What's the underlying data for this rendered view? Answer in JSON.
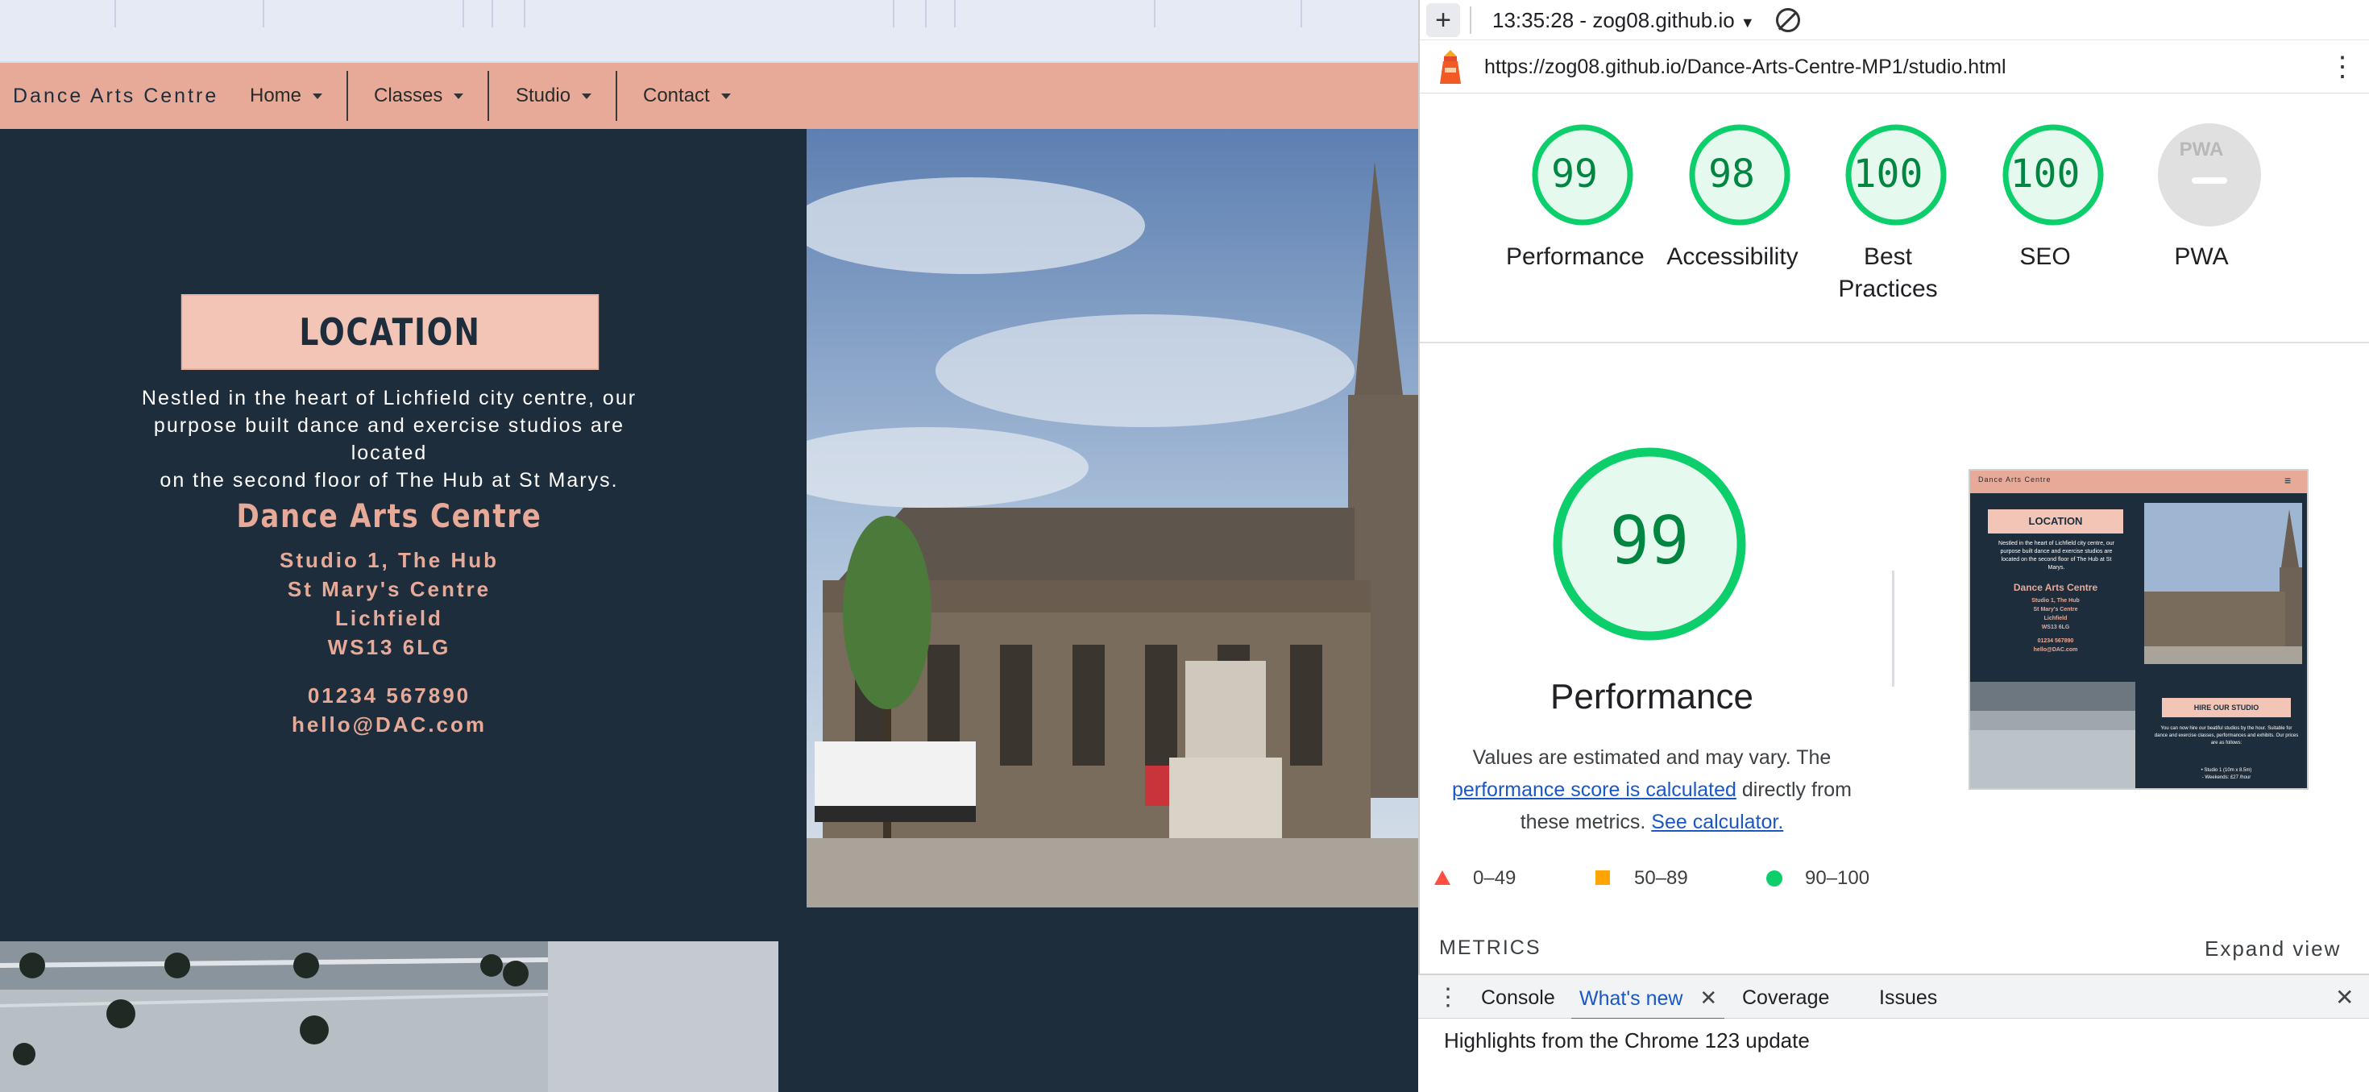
{
  "site": {
    "brand": "Dance Arts Centre",
    "nav": [
      {
        "label": "Home"
      },
      {
        "label": "Classes"
      },
      {
        "label": "Studio"
      },
      {
        "label": "Contact"
      }
    ],
    "location": {
      "heading": "LOCATION",
      "text_lines": [
        "Nestled in the heart of Lichfield city centre, our",
        "purpose built dance and exercise studios are located",
        "on the second floor of The Hub at St Marys."
      ],
      "name": "Dance Arts Centre",
      "address": [
        "Studio 1, The Hub",
        "St Mary's Centre",
        "Lichfield",
        "WS13 6LG"
      ],
      "phone": "01234 567890",
      "email": "hello@DAC.com"
    }
  },
  "devtools": {
    "top_bar": {
      "session": "13:35:28 - zog08.github.io"
    },
    "url": "https://zog08.github.io/Dance-Arts-Centre-MP1/studio.html",
    "scores": [
      {
        "value": "99",
        "label": "Performance",
        "color": "#0cce6b"
      },
      {
        "value": "98",
        "label": "Accessibility",
        "color": "#0cce6b"
      },
      {
        "value": "100",
        "label": "Best Practices",
        "label_lines": [
          "Best",
          "Practices"
        ],
        "color": "#0cce6b"
      },
      {
        "value": "100",
        "label": "SEO",
        "color": "#0cce6b"
      },
      {
        "value": "PWA",
        "label": "PWA",
        "color": "#b0b0b0"
      }
    ],
    "main_score": {
      "value": "99",
      "label": "Performance"
    },
    "description": {
      "part1": "Values are estimated and may vary. The",
      "link1": "performance score is calculated",
      "part2": "directly from",
      "part3": "these metrics.",
      "link2": "See calculator."
    },
    "legend": [
      {
        "range": "0–49",
        "color": "#ff4e42"
      },
      {
        "range": "50–89",
        "color": "#ffa400"
      },
      {
        "range": "90–100",
        "color": "#0cce6b"
      }
    ],
    "metrics_heading": "METRICS",
    "expand_label": "Expand view",
    "drawer": {
      "tabs": [
        "Console",
        "What's new",
        "Coverage",
        "Issues"
      ],
      "active_tab": "What's new",
      "body": "Highlights from the Chrome 123 update"
    },
    "thumbnail": {
      "brand": "Dance Arts Centre",
      "location": "LOCATION",
      "text": "Nestled in the heart of Lichfield city centre, our purpose built dance and exercise studios are located on the second floor of The Hub at St Marys.",
      "name": "Dance Arts Centre",
      "address": [
        "Studio 1, The Hub",
        "St Mary's Centre",
        "Lichfield",
        "WS13 6LG"
      ],
      "phone": "01234 567890",
      "email": "hello@DAC.com",
      "hire": "HIRE OUR STUDIO",
      "hire_text": "You can now hire our beatiful studios by the hour. Suitable for dance and exercise classes, performances and exhibits. Our prices are as follows:",
      "hire_items": [
        "• Studio 1 (10m x 8.5m)",
        "- Weekends: £27 /hour"
      ]
    }
  }
}
